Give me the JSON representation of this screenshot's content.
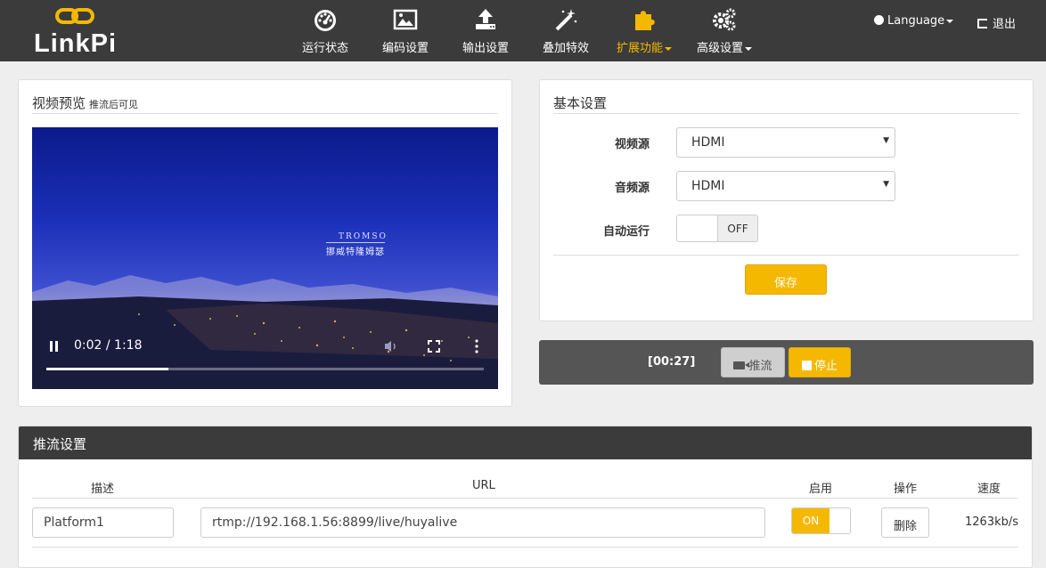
{
  "brand": {
    "name": "LinkPi"
  },
  "nav": [
    {
      "label": "运行状态",
      "icon": "dashboard-icon"
    },
    {
      "label": "编码设置",
      "icon": "image-icon"
    },
    {
      "label": "输出设置",
      "icon": "upload-icon"
    },
    {
      "label": "叠加特效",
      "icon": "magic-wand-icon"
    },
    {
      "label": "扩展功能",
      "icon": "puzzle-icon",
      "active": true,
      "dropdown": true
    },
    {
      "label": "高级设置",
      "icon": "gears-icon",
      "dropdown": true
    }
  ],
  "header_right": {
    "language": "Language",
    "logout": "退出"
  },
  "preview": {
    "title": "视频预览",
    "subtitle": "推流后可见",
    "caption_en": "TROMSO",
    "caption_zh": "挪威特隆姆瑟",
    "time": "0:02 / 1:18",
    "progress": 0.28
  },
  "basic": {
    "title": "基本设置",
    "video_source_label": "视频源",
    "video_source_value": "HDMI",
    "audio_source_label": "音频源",
    "audio_source_value": "HDMI",
    "autorun_label": "自动运行",
    "autorun_state": "OFF",
    "save_label": "保存"
  },
  "control": {
    "timer": "[00:27]",
    "push_label": "推流",
    "stop_label": "停止"
  },
  "stream": {
    "title": "推流设置",
    "headers": {
      "desc": "描述",
      "url": "URL",
      "enable": "启用",
      "action": "操作",
      "speed": "速度"
    },
    "rows": [
      {
        "desc": "Platform1",
        "url": "rtmp://192.168.1.56:8899/live/huyalive",
        "enabled": "ON",
        "delete": "删除",
        "speed": "1263kb/s"
      }
    ]
  },
  "colors": {
    "accent": "#f5b800",
    "topbar": "#3b3b3b",
    "control_bar": "#555555"
  }
}
